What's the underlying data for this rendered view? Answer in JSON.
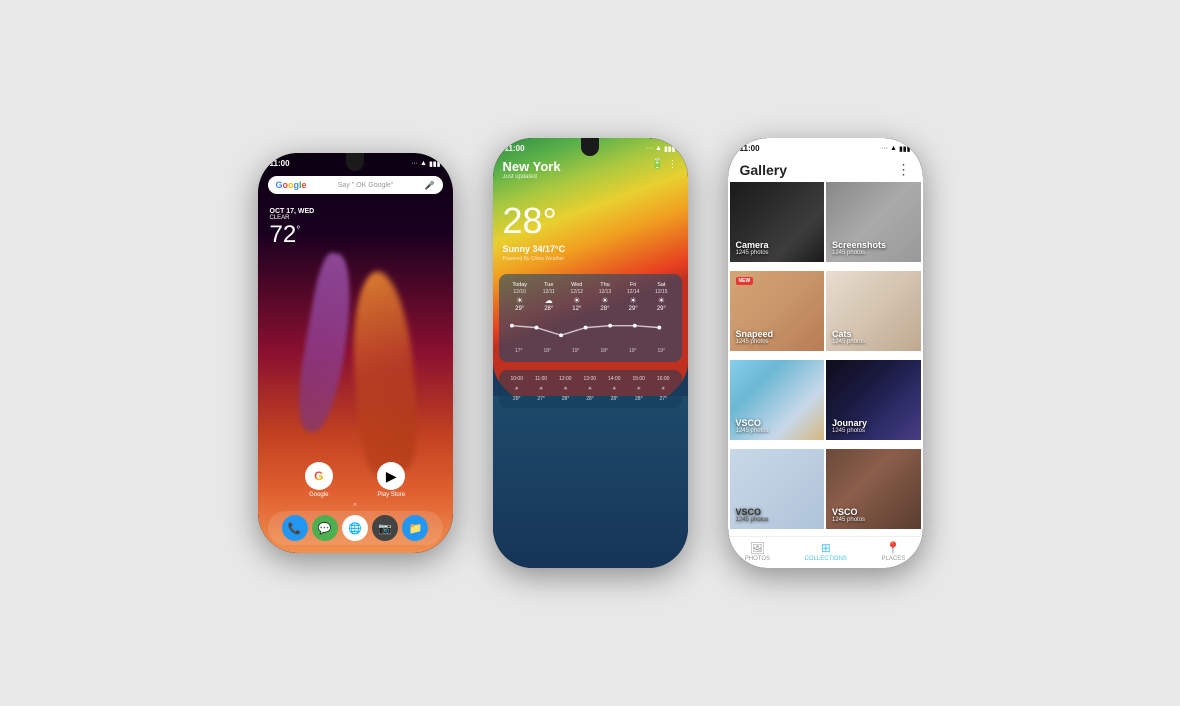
{
  "phone1": {
    "status": {
      "time": "11:00",
      "icons": "... ▲ ■"
    },
    "google": {
      "logo": "Google",
      "hint": "Say \" OK Google\"",
      "mic": "🎤"
    },
    "weather": {
      "date": "OCT 17, WED",
      "condition": "CLEAR",
      "temp": "72",
      "degree": "°"
    },
    "apps": [
      {
        "name": "Google",
        "label": "Google",
        "bg": "#fff",
        "icon": "G"
      }
    ],
    "dock": {
      "phone_label": "Phone",
      "messages_label": "Messages",
      "chrome_label": "Chrome",
      "camera_label": "Camera",
      "files_label": "Files"
    },
    "play_store_label": "Play Store"
  },
  "phone2": {
    "status": {
      "time": "11:00"
    },
    "city": "New York",
    "just_updated": "Just updated",
    "temp": "28°",
    "sunny": "Sunny 34/17°C",
    "powered": "Powered By China Weather",
    "forecast": [
      {
        "day": "Today",
        "date": "12/10",
        "icon": "☀",
        "hi": "29°",
        "lo": ""
      },
      {
        "day": "Tue",
        "date": "12/11",
        "icon": "☁",
        "hi": "28°",
        "lo": ""
      },
      {
        "day": "Wed",
        "date": "12/12",
        "icon": "☀",
        "hi": "12°",
        "lo": ""
      },
      {
        "day": "Thu",
        "date": "12/13",
        "icon": "☀",
        "hi": "28°",
        "lo": ""
      },
      {
        "day": "Fri",
        "date": "12/14",
        "icon": "☀",
        "hi": "29°",
        "lo": ""
      },
      {
        "day": "Sat",
        "date": "12/15",
        "icon": "☀",
        "hi": "29°",
        "lo": ""
      }
    ],
    "hourly": [
      {
        "time": "10:00",
        "icon": "☀",
        "temp": "28°"
      },
      {
        "time": "11:00",
        "icon": "☀",
        "temp": "27°"
      },
      {
        "time": "12:00",
        "icon": "☀",
        "temp": "28°"
      },
      {
        "time": "13:00",
        "icon": "☀",
        "temp": "28°"
      },
      {
        "time": "14:00",
        "icon": "☀",
        "temp": "28°"
      },
      {
        "time": "15:00",
        "icon": "☀",
        "temp": "28°"
      },
      {
        "time": "16:00",
        "icon": "☀",
        "temp": "27°"
      }
    ]
  },
  "phone3": {
    "status": {
      "time": "11:00"
    },
    "title": "Gallery",
    "more_icon": "⋮",
    "albums": [
      {
        "name": "Camera",
        "count": "1245 photos",
        "bg": "bg-camera",
        "new": false
      },
      {
        "name": "Screenshots",
        "count": "1245 photos",
        "bg": "bg-screenshots",
        "new": false
      },
      {
        "name": "Snapeed",
        "count": "1245 photos",
        "bg": "bg-snapeed",
        "new": true
      },
      {
        "name": "Cats",
        "count": "1245 photos",
        "bg": "bg-cats",
        "new": false
      },
      {
        "name": "VSCO",
        "count": "1245 photos",
        "bg": "bg-vsco1",
        "new": false
      },
      {
        "name": "Jounary",
        "count": "1245 photos",
        "bg": "bg-journey",
        "new": false
      },
      {
        "name": "VSCO",
        "count": "1245 photos",
        "bg": "bg-vsco2",
        "new": false
      },
      {
        "name": "VSCO",
        "count": "1245 photos",
        "bg": "bg-vsco3",
        "new": false
      }
    ],
    "tabs": [
      {
        "label": "PHOTOS",
        "icon": "🖼",
        "active": false
      },
      {
        "label": "COLLECTIONS",
        "icon": "⊞",
        "active": true
      },
      {
        "label": "PLACES",
        "icon": "📍",
        "active": false
      }
    ],
    "new_badge_label": "NEW"
  }
}
